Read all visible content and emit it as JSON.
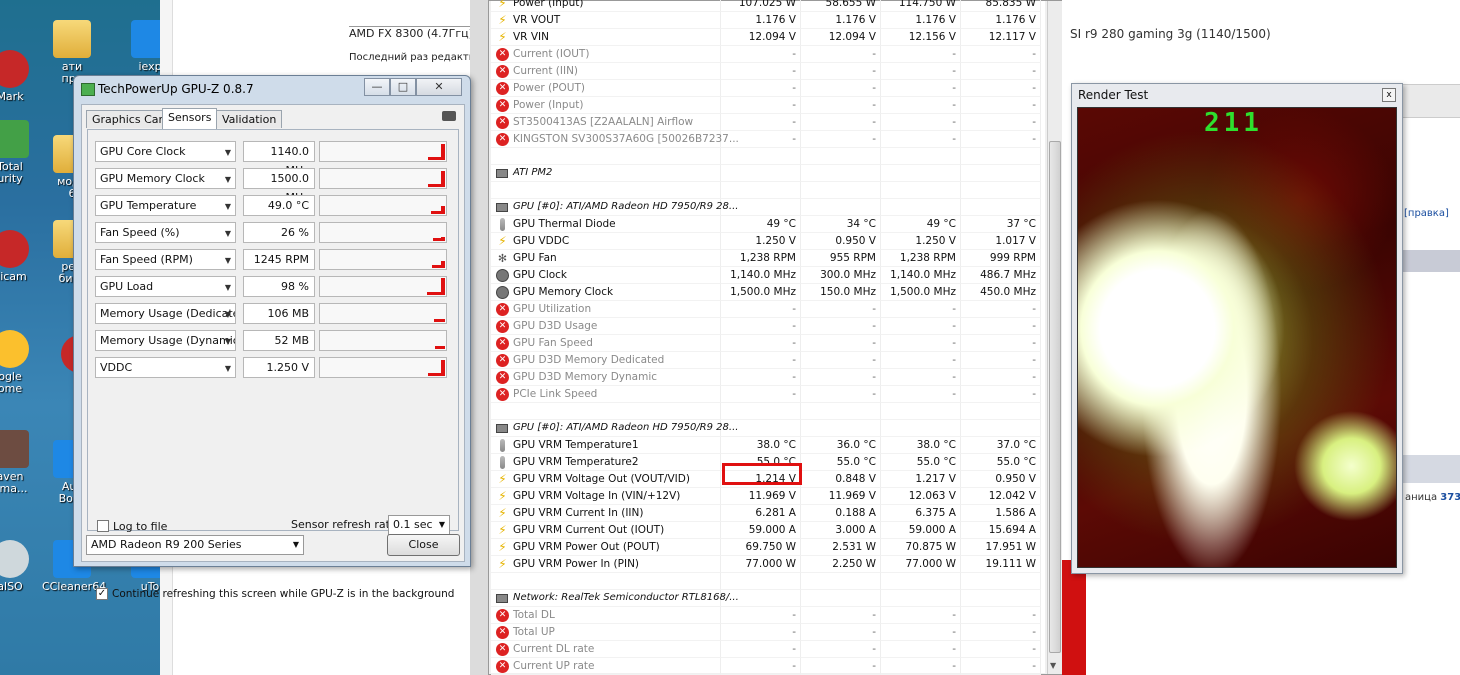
{
  "desktop": {
    "icons": [
      {
        "label": "Mark"
      },
      {
        "label": "ати\nпро"
      },
      {
        "label": "iexp"
      },
      {
        "label": "Total\nurity"
      },
      {
        "label": "моди\n6"
      },
      {
        "label": "dicam"
      },
      {
        "label": "ред\nбиос"
      },
      {
        "label": "ogle\nome"
      },
      {
        "label": "ai"
      },
      {
        "label": "aven\nnma..."
      },
      {
        "label": "Aus\nBoos"
      },
      {
        "label": "alSO"
      },
      {
        "label": "CCleaner64"
      },
      {
        "label": "uTo"
      }
    ]
  },
  "background_page": {
    "cpu_text": "AMD FX 8300 (4.7Ггц)",
    "edited_text": "Последний раз редактир",
    "gpu_text": "SI r9 280 gaming 3g (1140/1500)",
    "pravka": "[правка]",
    "page_label": "аница",
    "page_number": "373"
  },
  "gpuz": {
    "title": "TechPowerUp GPU-Z 0.8.7",
    "tabs": [
      "Graphics Card",
      "Sensors",
      "Validation"
    ],
    "active_tab": "Sensors",
    "sensors": [
      {
        "name": "GPU Core Clock",
        "value": "1140.0 MHz",
        "level": 0.92
      },
      {
        "name": "GPU Memory Clock",
        "value": "1500.0 MHz",
        "level": 0.92
      },
      {
        "name": "GPU Temperature",
        "value": "49.0 °C",
        "level": 0.45
      },
      {
        "name": "Fan Speed (%)",
        "value": "26 %",
        "level": 0.26
      },
      {
        "name": "Fan Speed (RPM)",
        "value": "1245 RPM",
        "level": 0.4
      },
      {
        "name": "GPU Load",
        "value": "98 %",
        "level": 0.98
      },
      {
        "name": "Memory Usage (Dedicated)",
        "value": "106 MB",
        "level": 0.1
      },
      {
        "name": "Memory Usage (Dynamic)",
        "value": "52 MB",
        "level": 0.05
      },
      {
        "name": "VDDC",
        "value": "1.250 V",
        "level": 0.92
      }
    ],
    "log_to_file": "Log to file",
    "refresh_label": "Sensor refresh rate:",
    "refresh_value": "0.1 sec",
    "continue_label": "Continue refreshing this screen while GPU-Z is in the background",
    "card_select": "AMD Radeon R9 200 Series",
    "close": "Close"
  },
  "hwinfo": {
    "rows": [
      {
        "icon": "bolt",
        "name": "Power (Input)",
        "v1": "107.025 W",
        "v2": "58.655 W",
        "v3": "114.750 W",
        "v4": "85.835 W",
        "disabled": false,
        "partial": true
      },
      {
        "icon": "bolt",
        "name": "VR VOUT",
        "v1": "1.176 V",
        "v2": "1.176 V",
        "v3": "1.176 V",
        "v4": "1.176 V",
        "disabled": false
      },
      {
        "icon": "bolt",
        "name": "VR VIN",
        "v1": "12.094 V",
        "v2": "12.094 V",
        "v3": "12.156 V",
        "v4": "12.117 V",
        "disabled": false
      },
      {
        "icon": "x",
        "name": "Current (IOUT)",
        "v1": "-",
        "v2": "-",
        "v3": "-",
        "v4": "-",
        "disabled": true
      },
      {
        "icon": "x",
        "name": "Current (IIN)",
        "v1": "-",
        "v2": "-",
        "v3": "-",
        "v4": "-",
        "disabled": true
      },
      {
        "icon": "x",
        "name": "Power (POUT)",
        "v1": "-",
        "v2": "-",
        "v3": "-",
        "v4": "-",
        "disabled": true
      },
      {
        "icon": "x",
        "name": "Power (Input)",
        "v1": "-",
        "v2": "-",
        "v3": "-",
        "v4": "-",
        "disabled": true
      },
      {
        "icon": "x",
        "name": "ST3500413AS [Z2AALALN] Airflow",
        "v1": "-",
        "v2": "-",
        "v3": "-",
        "v4": "-",
        "disabled": true
      },
      {
        "icon": "x",
        "name": "KINGSTON SV300S37A60G [50026B7237...",
        "v1": "-",
        "v2": "-",
        "v3": "-",
        "v4": "-",
        "disabled": true
      },
      {
        "icon": "blank",
        "name": "",
        "v1": "",
        "v2": "",
        "v3": "",
        "v4": "",
        "disabled": false
      },
      {
        "icon": "chip",
        "name": "ATI PM2",
        "v1": "",
        "v2": "",
        "v3": "",
        "v4": "",
        "group": true
      },
      {
        "icon": "blank",
        "name": "",
        "v1": "",
        "v2": "",
        "v3": "",
        "v4": "",
        "disabled": false
      },
      {
        "icon": "chip",
        "name": "GPU [#0]: ATI/AMD Radeon HD 7950/R9 28...",
        "v1": "",
        "v2": "",
        "v3": "",
        "v4": "",
        "group": true
      },
      {
        "icon": "therm",
        "name": "GPU Thermal Diode",
        "v1": "49 °C",
        "v2": "34 °C",
        "v3": "49 °C",
        "v4": "37 °C"
      },
      {
        "icon": "bolt",
        "name": "GPU VDDC",
        "v1": "1.250 V",
        "v2": "0.950 V",
        "v3": "1.250 V",
        "v4": "1.017 V"
      },
      {
        "icon": "fan",
        "name": "GPU Fan",
        "v1": "1,238 RPM",
        "v2": "955 RPM",
        "v3": "1,238 RPM",
        "v4": "999 RPM"
      },
      {
        "icon": "clock",
        "name": "GPU Clock",
        "v1": "1,140.0 MHz",
        "v2": "300.0 MHz",
        "v3": "1,140.0 MHz",
        "v4": "486.7 MHz"
      },
      {
        "icon": "clock",
        "name": "GPU Memory Clock",
        "v1": "1,500.0 MHz",
        "v2": "150.0 MHz",
        "v3": "1,500.0 MHz",
        "v4": "450.0 MHz"
      },
      {
        "icon": "x",
        "name": "GPU Utilization",
        "v1": "-",
        "v2": "-",
        "v3": "-",
        "v4": "-",
        "disabled": true
      },
      {
        "icon": "x",
        "name": "GPU D3D Usage",
        "v1": "-",
        "v2": "-",
        "v3": "-",
        "v4": "-",
        "disabled": true
      },
      {
        "icon": "x",
        "name": "GPU Fan Speed",
        "v1": "-",
        "v2": "-",
        "v3": "-",
        "v4": "-",
        "disabled": true
      },
      {
        "icon": "x",
        "name": "GPU D3D Memory Dedicated",
        "v1": "-",
        "v2": "-",
        "v3": "-",
        "v4": "-",
        "disabled": true
      },
      {
        "icon": "x",
        "name": "GPU D3D Memory Dynamic",
        "v1": "-",
        "v2": "-",
        "v3": "-",
        "v4": "-",
        "disabled": true
      },
      {
        "icon": "x",
        "name": "PCIe Link Speed",
        "v1": "-",
        "v2": "-",
        "v3": "-",
        "v4": "-",
        "disabled": true
      },
      {
        "icon": "blank",
        "name": "",
        "v1": "",
        "v2": "",
        "v3": "",
        "v4": ""
      },
      {
        "icon": "chip",
        "name": "GPU [#0]: ATI/AMD Radeon HD 7950/R9 28...",
        "v1": "",
        "v2": "",
        "v3": "",
        "v4": "",
        "group": true
      },
      {
        "icon": "therm",
        "name": "GPU VRM Temperature1",
        "v1": "38.0 °C",
        "v2": "36.0 °C",
        "v3": "38.0 °C",
        "v4": "37.0 °C"
      },
      {
        "icon": "therm",
        "name": "GPU VRM Temperature2",
        "v1": "55.0 °C",
        "v2": "55.0 °C",
        "v3": "55.0 °C",
        "v4": "55.0 °C"
      },
      {
        "icon": "bolt",
        "name": "GPU VRM Voltage Out (VOUT/VID)",
        "v1": "1.214 V",
        "v2": "0.848 V",
        "v3": "1.217 V",
        "v4": "0.950 V"
      },
      {
        "icon": "bolt",
        "name": "GPU VRM Voltage In (VIN/+12V)",
        "v1": "11.969 V",
        "v2": "11.969 V",
        "v3": "12.063 V",
        "v4": "12.042 V"
      },
      {
        "icon": "bolt",
        "name": "GPU VRM Current In (IIN)",
        "v1": "6.281 A",
        "v2": "0.188 A",
        "v3": "6.375 A",
        "v4": "1.586 A"
      },
      {
        "icon": "bolt",
        "name": "GPU VRM Current Out (IOUT)",
        "v1": "59.000 A",
        "v2": "3.000 A",
        "v3": "59.000 A",
        "v4": "15.694 A"
      },
      {
        "icon": "bolt",
        "name": "GPU VRM Power Out (POUT)",
        "v1": "69.750 W",
        "v2": "2.531 W",
        "v3": "70.875 W",
        "v4": "17.951 W"
      },
      {
        "icon": "bolt",
        "name": "GPU VRM Power In (PIN)",
        "v1": "77.000 W",
        "v2": "2.250 W",
        "v3": "77.000 W",
        "v4": "19.111 W"
      },
      {
        "icon": "blank",
        "name": "",
        "v1": "",
        "v2": "",
        "v3": "",
        "v4": ""
      },
      {
        "icon": "chip",
        "name": "Network: RealTek Semiconductor RTL8168/...",
        "v1": "",
        "v2": "",
        "v3": "",
        "v4": "",
        "group": true
      },
      {
        "icon": "x",
        "name": "Total DL",
        "v1": "-",
        "v2": "-",
        "v3": "-",
        "v4": "-",
        "disabled": true
      },
      {
        "icon": "x",
        "name": "Total UP",
        "v1": "-",
        "v2": "-",
        "v3": "-",
        "v4": "-",
        "disabled": true
      },
      {
        "icon": "x",
        "name": "Current DL rate",
        "v1": "-",
        "v2": "-",
        "v3": "-",
        "v4": "-",
        "disabled": true
      },
      {
        "icon": "x",
        "name": "Current UP rate",
        "v1": "-",
        "v2": "-",
        "v3": "-",
        "v4": "-",
        "disabled": true
      }
    ]
  },
  "render_test": {
    "title": "Render Test",
    "fps": "211",
    "close": "x"
  }
}
